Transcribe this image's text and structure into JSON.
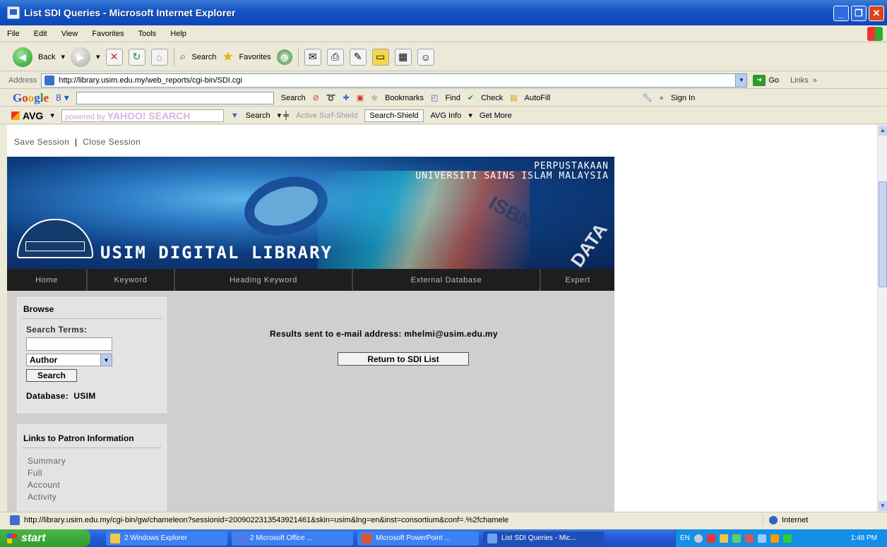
{
  "window": {
    "title": "List SDI Queries - Microsoft Internet Explorer"
  },
  "menu": [
    "File",
    "Edit",
    "View",
    "Favorites",
    "Tools",
    "Help"
  ],
  "toolbar": {
    "back": "Back",
    "search": "Search",
    "favorites": "Favorites"
  },
  "address": {
    "label": "Address",
    "url": "http://library.usim.edu.my/web_reports/cgi-bin/SDI.cgi",
    "go": "Go",
    "links": "Links"
  },
  "google_bar": {
    "logo": [
      "G",
      "o",
      "o",
      "g",
      "l",
      "e"
    ],
    "g_box": "8",
    "search": "Search",
    "bookmarks": "Bookmarks",
    "find": "Find",
    "check": "Check",
    "autofill": "AutoFill",
    "sign_in": "Sign In"
  },
  "avg_bar": {
    "logo": "AVG",
    "powered": "powered by",
    "yahoo": "YAHOO! SEARCH",
    "search": "Search",
    "active_surf": "Active Surf-Shield",
    "search_shield": "Search-Shield",
    "avg_info": "AVG Info",
    "get_more": "Get More"
  },
  "session": {
    "save": "Save Session",
    "sep": "|",
    "close": "Close Session"
  },
  "banner": {
    "line1": "PERPUSTAKAAN",
    "line2": "UNIVERSITI SAINS ISLAM MALAYSIA",
    "title": "USIM DIGITAL LIBRARY",
    "isbn": "ISBN",
    "data": "DATA"
  },
  "nav": [
    "Home",
    "Keyword",
    "Heading Keyword",
    "External Database",
    "Expert"
  ],
  "browse": {
    "heading": "Browse",
    "search_terms_label": "Search Terms:",
    "search_value": "",
    "field_select": "Author",
    "search_button": "Search",
    "database_label": "Database:",
    "database_value": "USIM"
  },
  "patron": {
    "heading": "Links to Patron Information",
    "links": [
      "Summary",
      "Full",
      "Account",
      "Activity"
    ]
  },
  "result": {
    "message": "Results sent to e-mail address: mhelmi@usim.edu.my",
    "return_button": "Return to SDI List"
  },
  "status": {
    "url": "http://library.usim.edu.my/cgi-bin/gw/chameleon?sessionid=2009022313543921461&skin=usim&lng=en&inst=consortium&conf=.%2fchamele",
    "zone": "Internet"
  },
  "taskbar": {
    "start": "start",
    "tasks": [
      "2 Windows Explorer",
      "2 Microsoft Office ...",
      "Microsoft PowerPoint ...",
      "List SDI Queries - Mic..."
    ],
    "lang": "EN",
    "clock": "1:48 PM"
  },
  "colors": {
    "nav_bg": "#1e1e1e",
    "content_gray": "#cfcfcf",
    "xp_blue": "#245edb"
  }
}
